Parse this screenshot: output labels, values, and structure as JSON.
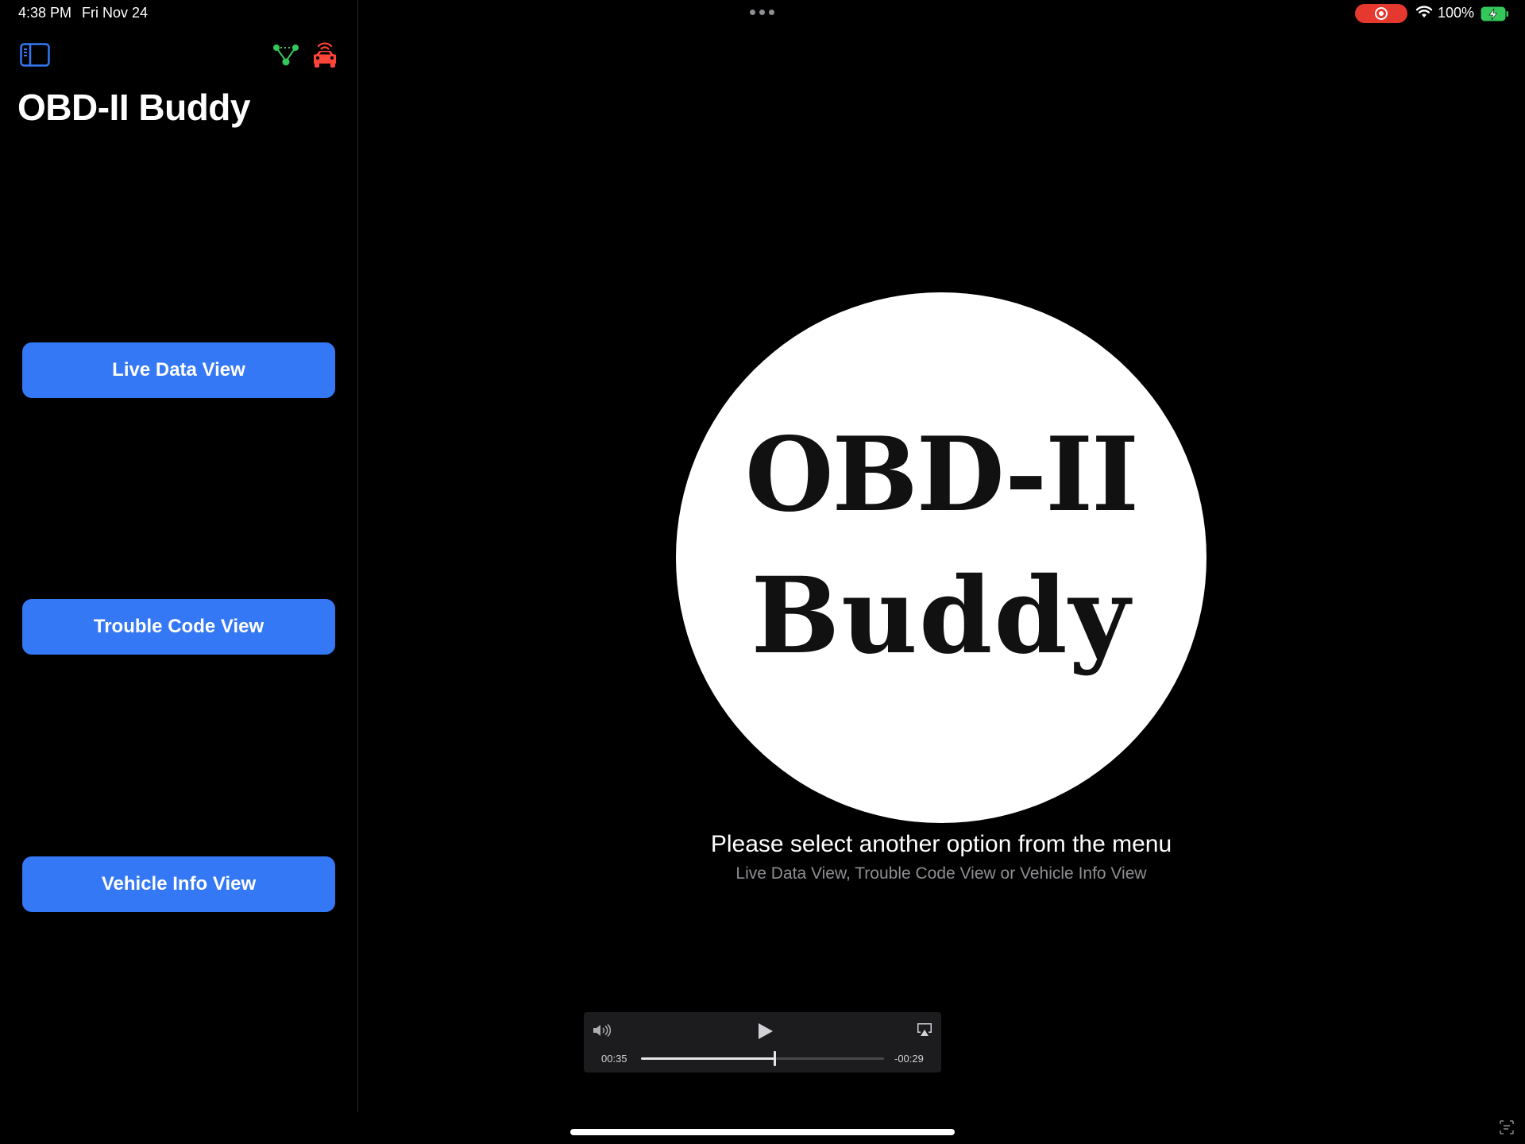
{
  "status_bar": {
    "time": "4:38 PM",
    "date": "Fri Nov 24",
    "battery": "100%",
    "icons": [
      "multitasking-dots-icon",
      "screen-record-icon",
      "wifi-icon",
      "battery-charging-icon"
    ]
  },
  "sidebar": {
    "title": "OBD-II Buddy",
    "icons": [
      "sidebar-toggle-icon",
      "connection-status-icon",
      "car-icon"
    ],
    "buttons": [
      {
        "label": "Live Data View"
      },
      {
        "label": "Trouble Code View"
      },
      {
        "label": "Vehicle Info View"
      }
    ]
  },
  "main": {
    "logo": {
      "line1": "OBD-II",
      "line2": "Buddy"
    },
    "message": "Please select another option from the menu",
    "sub_message": "Live Data View, Trouble Code View or Vehicle Info View"
  },
  "player": {
    "elapsed": "00:35",
    "remaining": "-00:29",
    "progress": 0.55
  },
  "colors": {
    "accent": "#3478f6",
    "record": "#e5392f",
    "connected": "#34c759",
    "car": "#ff453a",
    "battery": "#34c759"
  }
}
